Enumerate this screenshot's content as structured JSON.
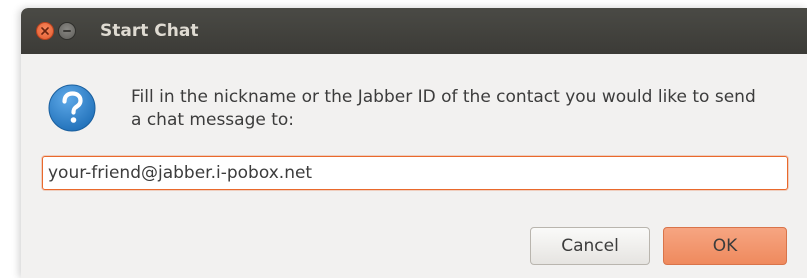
{
  "window": {
    "title": "Start Chat"
  },
  "icons": {
    "close": "close-icon",
    "minimize": "minimize-icon",
    "dialog": "question-icon"
  },
  "dialog": {
    "message": "Fill in the nickname or the Jabber ID of the contact you would like to send a chat message to:",
    "input_value": "your-friend@jabber.i-pobox.net"
  },
  "buttons": {
    "cancel_label": "Cancel",
    "ok_label": "OK"
  },
  "colors": {
    "titlebar": "#3c3b37",
    "accent": "#e9692c",
    "ok_button": "#f09a73",
    "question_icon": "#2a7fc5"
  }
}
